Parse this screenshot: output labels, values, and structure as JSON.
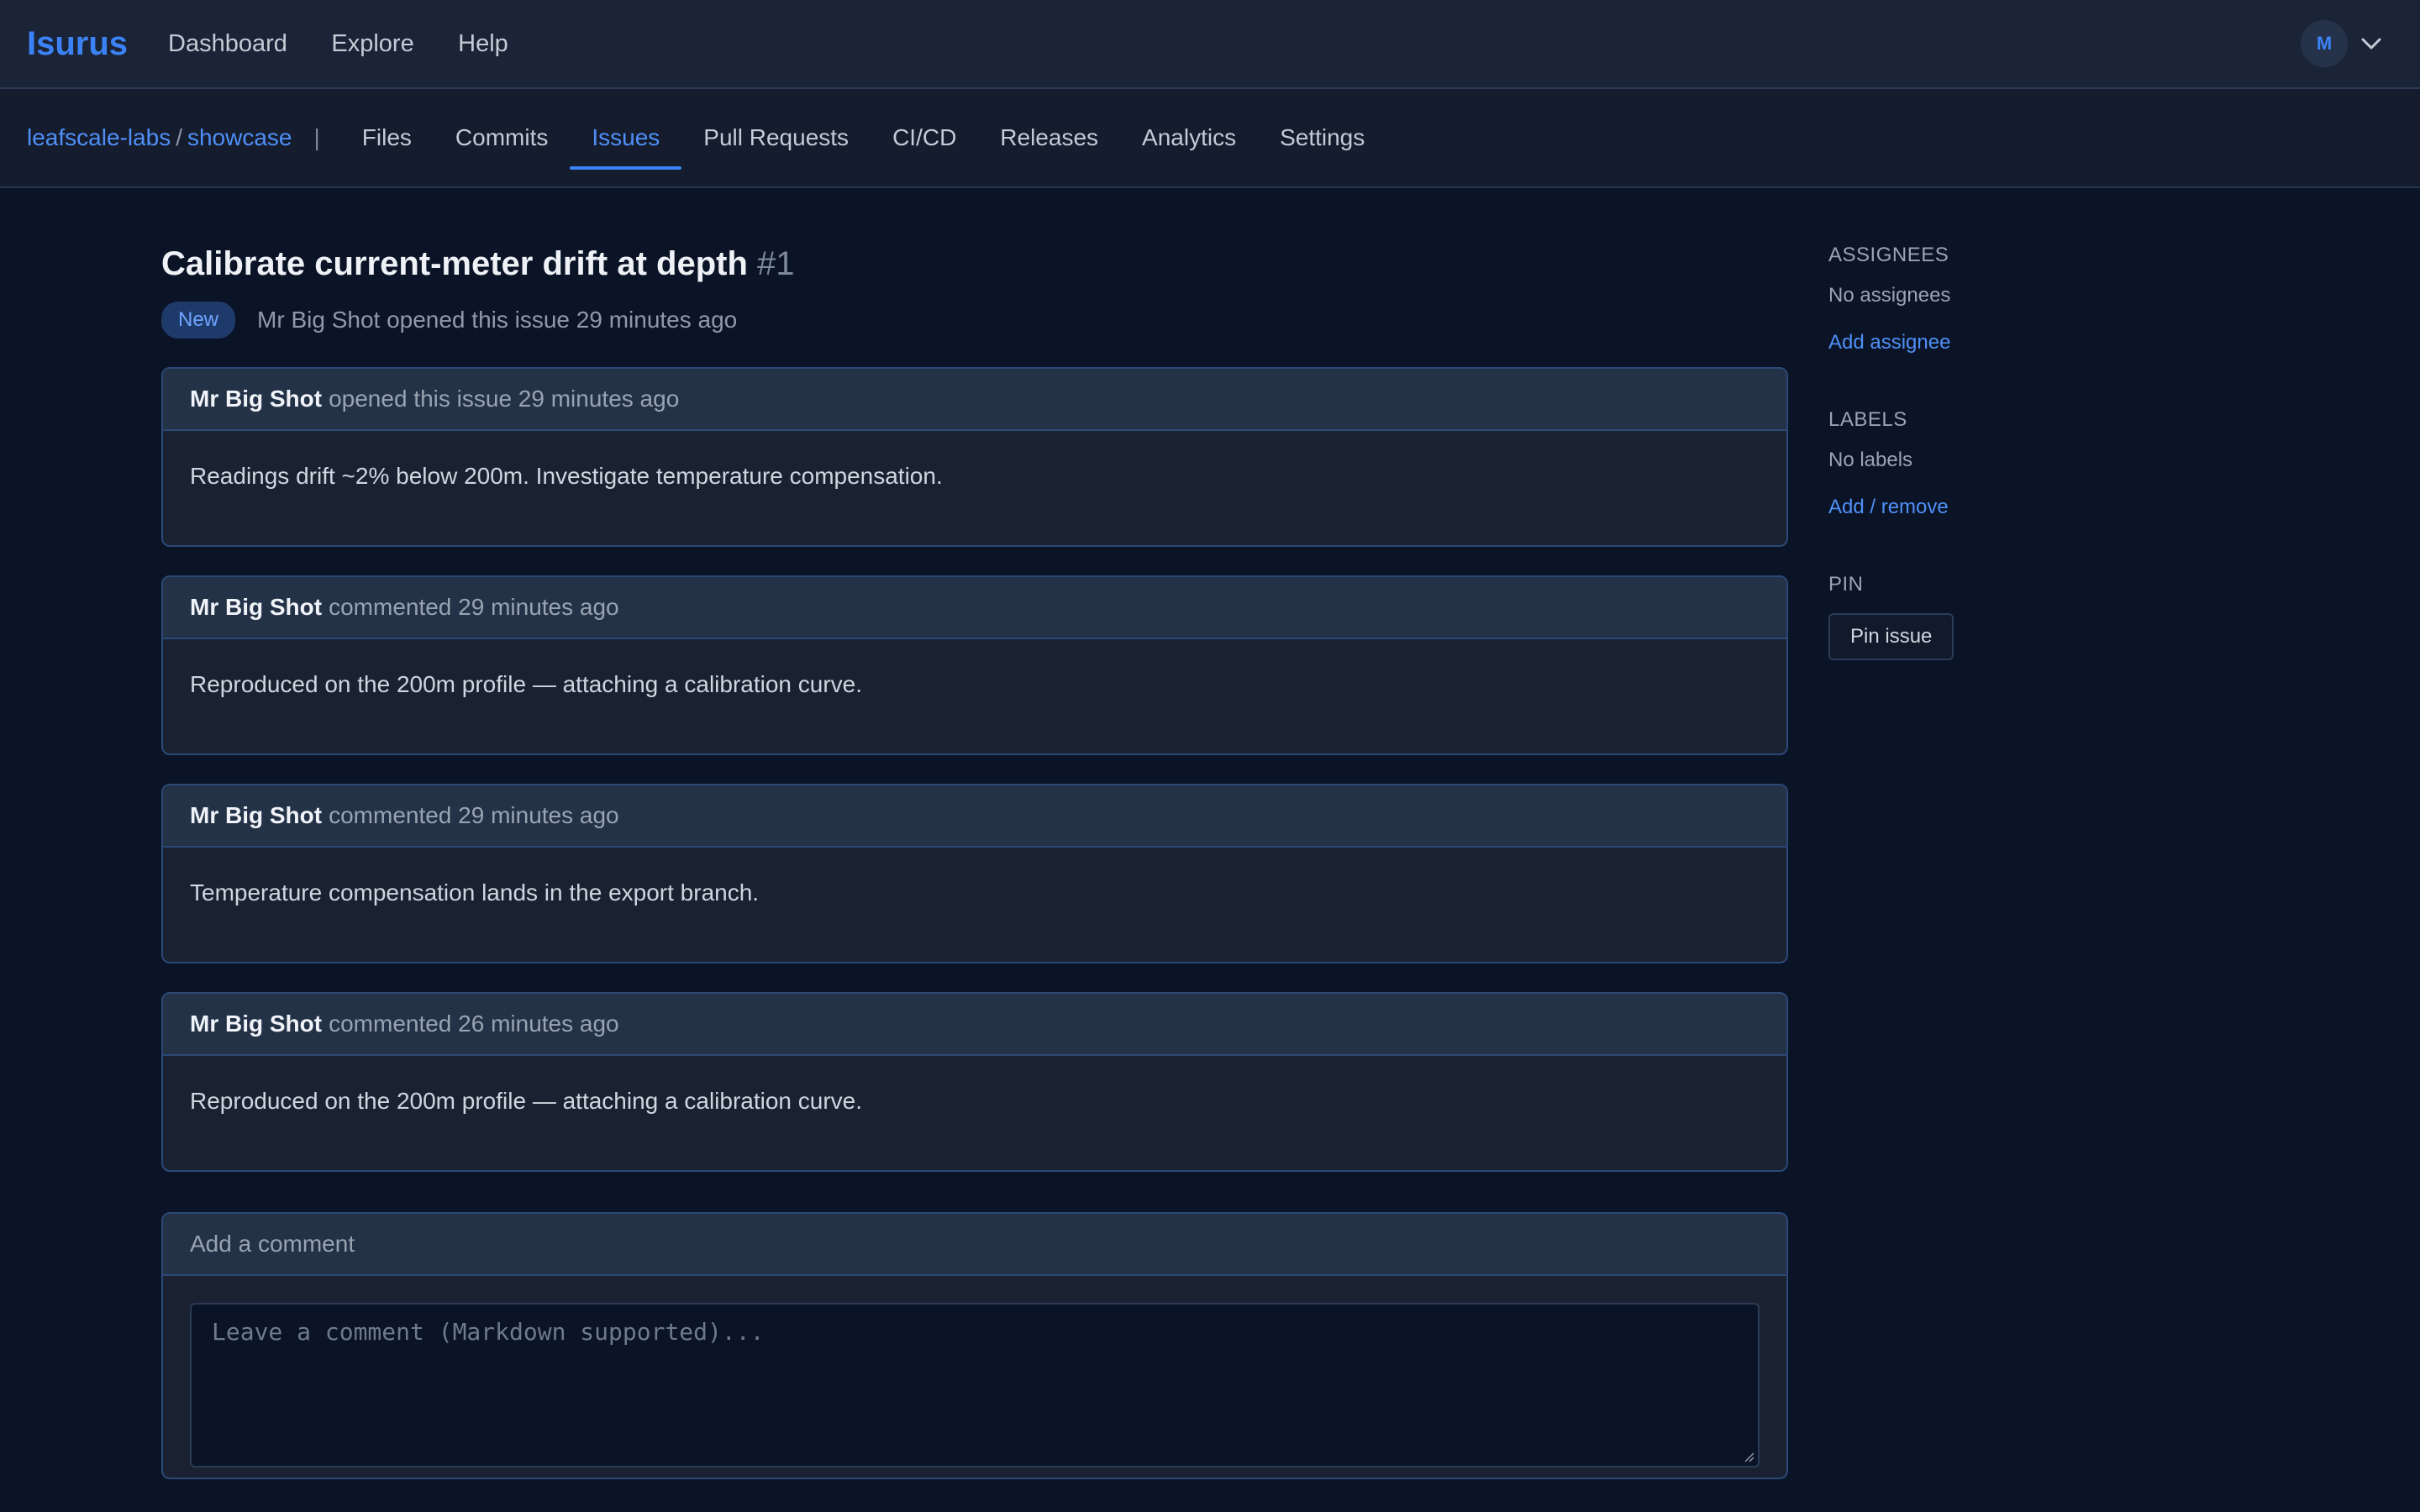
{
  "app": {
    "brand": "Isurus"
  },
  "topnav": {
    "items": [
      "Dashboard",
      "Explore",
      "Help"
    ]
  },
  "user": {
    "initial": "M"
  },
  "repo": {
    "owner": "leafscale-labs",
    "separator": "/",
    "name": "showcase",
    "divider": "|"
  },
  "tabs": [
    "Files",
    "Commits",
    "Issues",
    "Pull Requests",
    "CI/CD",
    "Releases",
    "Analytics",
    "Settings"
  ],
  "active_tab": "Issues",
  "issue": {
    "title": "Calibrate current-meter drift at depth",
    "number": "#1",
    "status": "New",
    "summary": "Mr Big Shot opened this issue 29 minutes ago"
  },
  "timeline": [
    {
      "author": "Mr Big Shot",
      "action": "opened this issue 29 minutes ago",
      "body": "Readings drift ~2% below 200m. Investigate temperature compensation."
    },
    {
      "author": "Mr Big Shot",
      "action": "commented 29 minutes ago",
      "body": "Reproduced on the 200m profile — attaching a calibration curve."
    },
    {
      "author": "Mr Big Shot",
      "action": "commented 29 minutes ago",
      "body": "Temperature compensation lands in the export branch."
    },
    {
      "author": "Mr Big Shot",
      "action": "commented 26 minutes ago",
      "body": "Reproduced on the 200m profile — attaching a calibration curve."
    }
  ],
  "comment_form": {
    "heading": "Add a comment",
    "placeholder": "Leave a comment (Markdown supported)..."
  },
  "sidebar": {
    "assignees": {
      "heading": "ASSIGNEES",
      "value": "No assignees",
      "action": "Add assignee"
    },
    "labels": {
      "heading": "LABELS",
      "value": "No labels",
      "action": "Add / remove"
    },
    "pin": {
      "heading": "PIN",
      "button": "Pin issue"
    }
  },
  "colors": {
    "accent": "#3b82f6",
    "background": "#0b1426",
    "badge_bg": "#1e3a6b"
  },
  "icons": {
    "user_menu": "chevron-down-icon"
  }
}
